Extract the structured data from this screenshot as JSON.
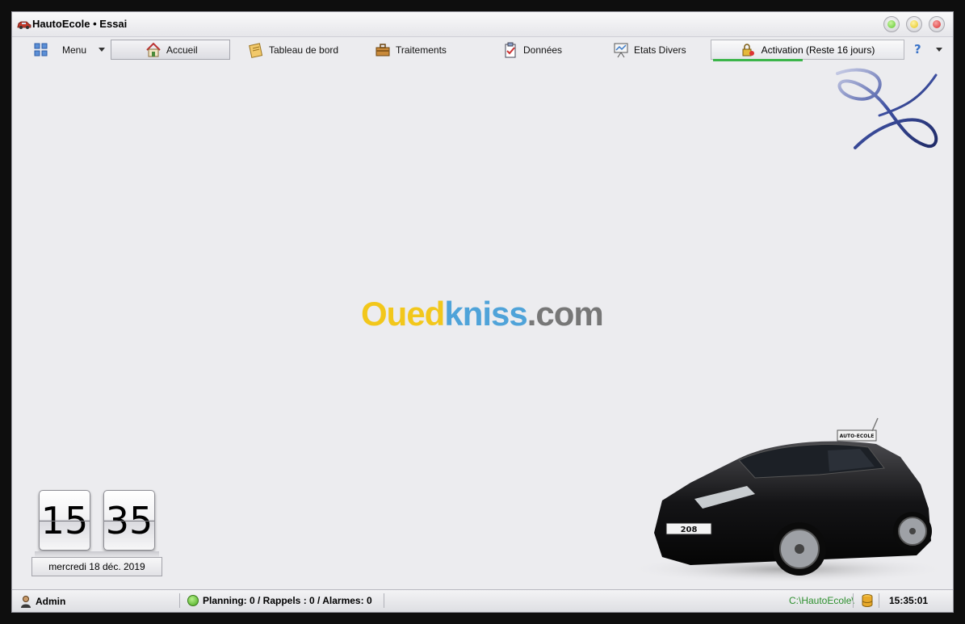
{
  "window": {
    "title": "HautoEcole • Essai"
  },
  "toolbar": {
    "menu_label": "Menu",
    "items": [
      {
        "label": "Accueil",
        "icon": "home-icon"
      },
      {
        "label": "Tableau de bord",
        "icon": "notepad-icon"
      },
      {
        "label": "Traitements",
        "icon": "toolbox-icon"
      },
      {
        "label": "Données",
        "icon": "clipboard-icon"
      },
      {
        "label": "Etats Divers",
        "icon": "presentation-board-icon"
      }
    ],
    "activation_label": "Activation (Reste 16 jours)",
    "activation_progress": 0.47,
    "help_label": "?"
  },
  "watermark": {
    "part1": "Oued",
    "part2": "kniss",
    "part3": ".com"
  },
  "clock": {
    "hours": "15",
    "minutes": "35",
    "date": "mercredi 18 déc. 2019"
  },
  "car": {
    "roof_sign": "AUTO-ECOLE",
    "plate": "208"
  },
  "statusbar": {
    "user": "Admin",
    "counters": "Planning: 0 / Rappels : 0 / Alarmes: 0",
    "path": "C:\\HautoEcole\\",
    "time": "15:35:01"
  },
  "colors": {
    "progress_green": "#3bb54a",
    "status_green": "#46a81c",
    "close_red": "#d92b2b",
    "min_yellow": "#e4c41a",
    "max_green": "#5cc72e"
  }
}
